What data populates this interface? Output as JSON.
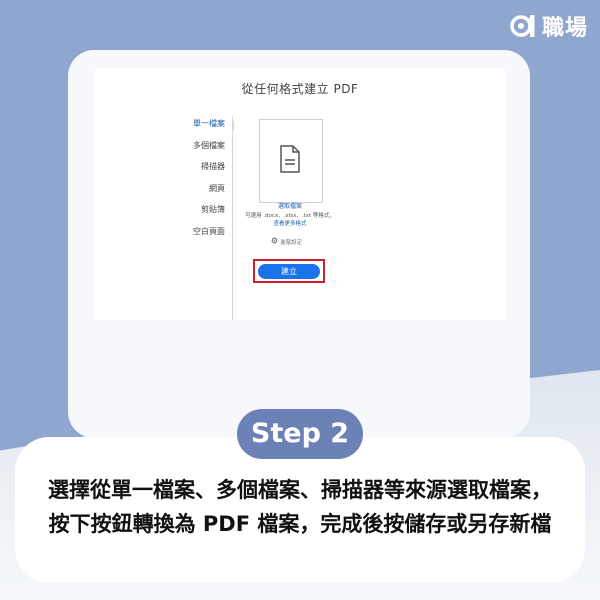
{
  "brand": {
    "logo_text": "職場"
  },
  "screenshot": {
    "title": "從任何格式建立 PDF",
    "sidebar": [
      {
        "label": "單一檔案",
        "active": true
      },
      {
        "label": "多個檔案",
        "active": false
      },
      {
        "label": "掃描器",
        "active": false
      },
      {
        "label": "網頁",
        "active": false
      },
      {
        "label": "剪貼簿",
        "active": false
      },
      {
        "label": "空白頁面",
        "active": false
      }
    ],
    "pick_file": "選取檔案",
    "formats_text": "可選用 .docx、.xlsx、.txt 等格式，",
    "more_formats": "查看更多格式",
    "settings": "進階設定",
    "create_button": "建立"
  },
  "step_label": "Step 2",
  "caption": "選擇從單一檔案、多個檔案、掃描器等來源選取檔案，按下按鈕轉換為 PDF 檔案，完成後按儲存或另存新檔",
  "colors": {
    "background": "#8fa6cf",
    "accent_blue": "#1a73e8",
    "highlight_red": "#c8202a",
    "step_pill": "#6c82b6"
  }
}
